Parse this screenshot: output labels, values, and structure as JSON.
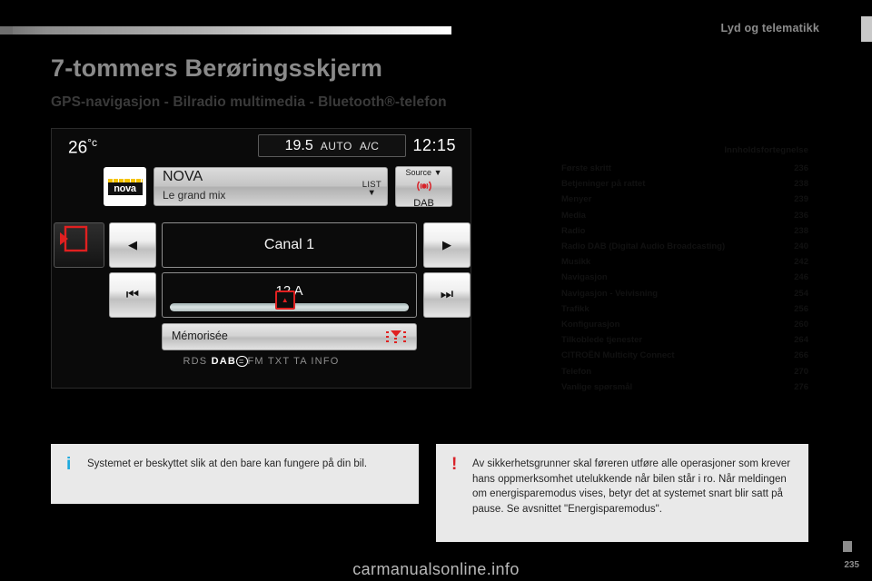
{
  "header": {
    "section_label": "Lyd og telematikk"
  },
  "page": {
    "title": "7-tommers Berøringsskjerm",
    "subtitle": "GPS-navigasjon - Bilradio multimedia - Bluetooth®-telefon",
    "page_number": "235",
    "watermark": "carmanualsonline.info"
  },
  "head_unit": {
    "temperature": "26",
    "temperature_unit": "°c",
    "climate_value": "19.5",
    "climate_auto": "AUTO",
    "climate_ac": "A/C",
    "clock": "12:15",
    "station_logo": "nova",
    "station_name": "NOVA",
    "station_subtitle": "Le grand mix",
    "list_label": "LIST",
    "source_label": "Source",
    "source_name": "DAB",
    "channel": "Canal 1",
    "frequency": "12 A",
    "memory_label": "Mémorisée",
    "status_items": [
      "RDS",
      "DAB",
      "FM",
      "TXT",
      "TA",
      "INFO"
    ],
    "arrow_left": "◀",
    "arrow_right": "▶",
    "prev_track": "⏮",
    "next_track": "⏭",
    "knob_glyph": "▲",
    "dropdown_glyph": "▼"
  },
  "toc": {
    "title": "Innholdsfortegnelse",
    "rows": [
      {
        "label": "Første skritt",
        "page": "236"
      },
      {
        "label": "Betjeninger på rattet",
        "page": "238"
      },
      {
        "label": "Menyer",
        "page": "239"
      },
      {
        "label": "Media",
        "page": "236"
      },
      {
        "label": "Radio",
        "page": "238"
      },
      {
        "label": "Radio DAB (Digital Audio Broadcasting)",
        "page": "240"
      },
      {
        "label": "Musikk",
        "page": "242"
      },
      {
        "label": "Navigasjon",
        "page": "246"
      },
      {
        "label": "Navigasjon - Veivisning",
        "page": "254"
      },
      {
        "label": "Trafikk",
        "page": "256"
      },
      {
        "label": "Konfigurasjon",
        "page": "260"
      },
      {
        "label": "Tilkoblede tjenester",
        "page": "264"
      },
      {
        "label": "CITROËN Multicity Connect",
        "page": "266"
      },
      {
        "label": "Telefon",
        "page": "270"
      },
      {
        "label": "Vanlige spørsmål",
        "page": "276"
      }
    ]
  },
  "info_box": {
    "marker": "i",
    "text": "Systemet er beskyttet slik at den bare kan fungere på din bil."
  },
  "warning_box": {
    "marker": "!",
    "text": "Av sikkerhetsgrunner skal føreren utføre alle operasjoner som krever hans oppmerksomhet utelukkende når bilen står i ro. Når meldingen om energisparemodus vises, betyr det at systemet snart blir satt på pause. Se avsnittet \"Energisparemodus\"."
  },
  "colors": {
    "accent_red": "#d8232a",
    "info_blue": "#1ba9dd",
    "logo_yellow": "#f5c400"
  }
}
